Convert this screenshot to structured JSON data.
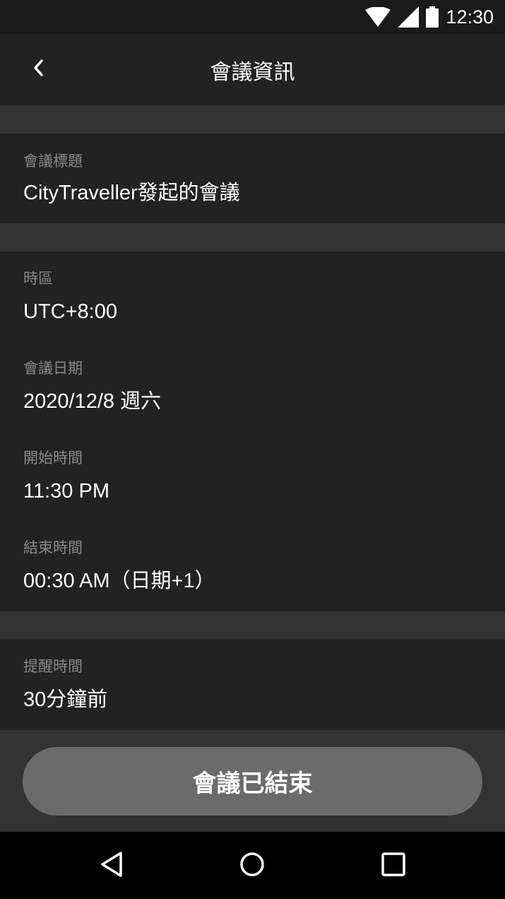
{
  "status_bar": {
    "time": "12:30",
    "icons": [
      "wifi-icon",
      "signal-icon",
      "battery-icon"
    ]
  },
  "header": {
    "title": "會議資訊",
    "back_icon": "chevron-left-icon"
  },
  "meeting": {
    "title_label": "會議標題",
    "title_value": "CityTraveller發起的會議",
    "timezone_label": "時區",
    "timezone_value": "UTC+8:00",
    "date_label": "會議日期",
    "date_value": "2020/12/8 週六",
    "start_label": "開始時間",
    "start_value": "11:30 PM",
    "end_label": "結束時間",
    "end_value": "00:30 AM（日期+1）",
    "reminder_label": "提醒時間",
    "reminder_value": "30分鐘前"
  },
  "footer": {
    "button_label": "會議已結束"
  },
  "nav_bar": {
    "icons": [
      "back-triangle-icon",
      "home-circle-icon",
      "recents-square-icon"
    ]
  },
  "colors": {
    "background": "#333333",
    "card": "#222222",
    "label": "#8a8a8a",
    "button": "#6b6b6b"
  }
}
